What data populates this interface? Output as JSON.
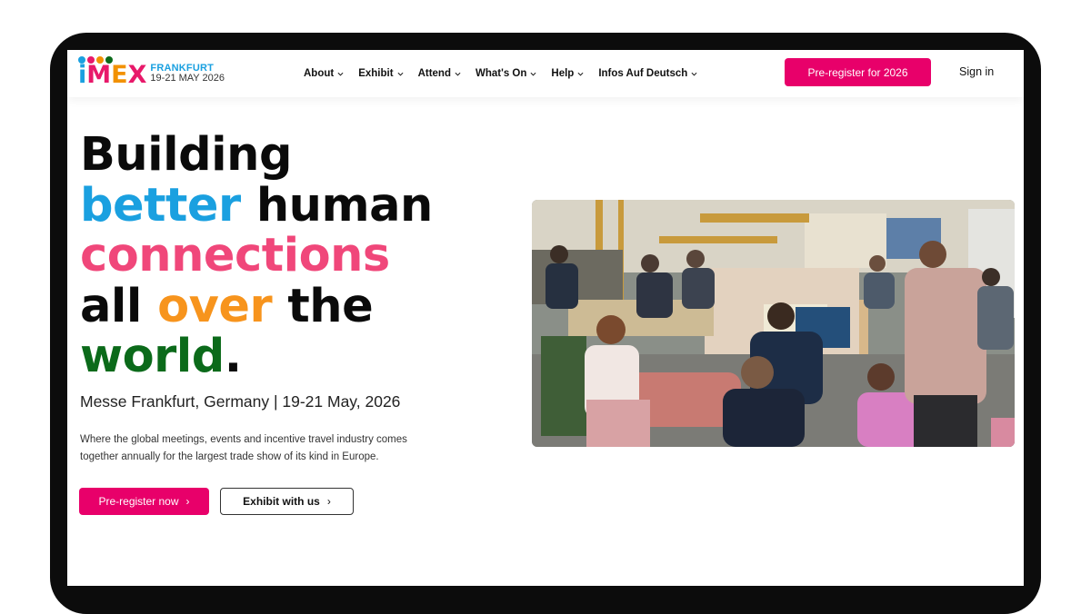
{
  "logo": {
    "letters": [
      "i",
      "M",
      "E",
      "X"
    ],
    "city": "FRANKFURT",
    "dates": "19-21 MAY 2026",
    "dot_colors": [
      "#1aa0e0",
      "#e8196a",
      "#f29100",
      "#0b6a1a"
    ]
  },
  "nav": {
    "items": [
      {
        "label": "About"
      },
      {
        "label": "Exhibit"
      },
      {
        "label": "Attend"
      },
      {
        "label": "What's On"
      },
      {
        "label": "Help"
      },
      {
        "label": "Infos Auf Deutsch"
      }
    ],
    "cta_label": "Pre-register for 2026",
    "signin_label": "Sign in"
  },
  "hero": {
    "line1": "Building",
    "line2_a": "better",
    "line2_b": " human",
    "line3": "connections",
    "line4_a": "all ",
    "line4_b": "over",
    "line4_c": " the",
    "line5_a": "world",
    "line5_b": ".",
    "subtitle": "Messe Frankfurt, Germany | 19-21 May, 2026",
    "description": "Where the global meetings, events and incentive travel industry comes together annually for the largest trade show of its kind in Europe.",
    "primary_button": "Pre-register now",
    "secondary_button": "Exhibit with us",
    "arrow_glyph": "›"
  },
  "colors": {
    "brand_pink": "#e8006a",
    "blue": "#1aa0e0",
    "pink": "#f0477a",
    "orange": "#f7941d",
    "green": "#0b6a1a"
  }
}
